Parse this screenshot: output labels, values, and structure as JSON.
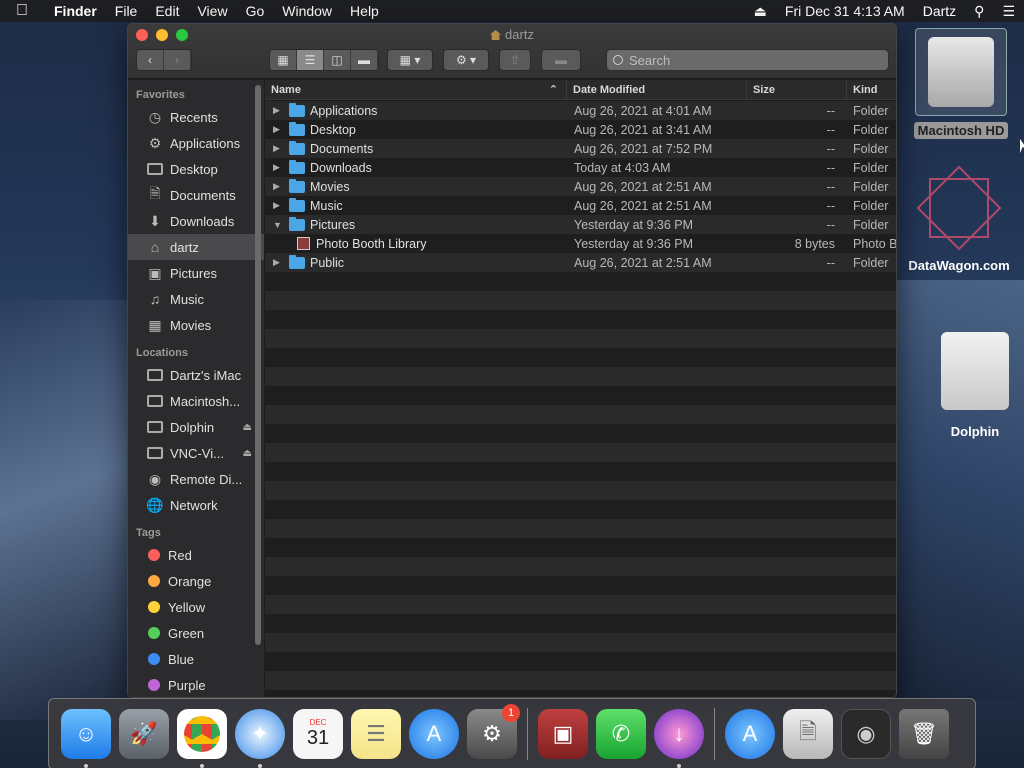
{
  "menubar": {
    "apple": "",
    "items": [
      "Finder",
      "File",
      "Edit",
      "View",
      "Go",
      "Window",
      "Help"
    ],
    "clock": "Fri Dec 31  4:13 AM",
    "user": "Dartz"
  },
  "window": {
    "title": "dartz",
    "search_placeholder": "Search"
  },
  "sidebar": {
    "favorites_header": "Favorites",
    "favorites": [
      {
        "label": "Recents",
        "icon": "clock-icon"
      },
      {
        "label": "Applications",
        "icon": "applications-icon"
      },
      {
        "label": "Desktop",
        "icon": "desktop-icon"
      },
      {
        "label": "Documents",
        "icon": "documents-icon"
      },
      {
        "label": "Downloads",
        "icon": "downloads-icon"
      },
      {
        "label": "dartz",
        "icon": "home-icon"
      },
      {
        "label": "Pictures",
        "icon": "camera-icon"
      },
      {
        "label": "Music",
        "icon": "music-icon"
      },
      {
        "label": "Movies",
        "icon": "film-icon"
      }
    ],
    "locations_header": "Locations",
    "locations": [
      {
        "label": "Dartz's iMac",
        "icon": "imac-icon"
      },
      {
        "label": "Macintosh...",
        "icon": "hard-drive-icon"
      },
      {
        "label": "Dolphin",
        "icon": "drive-icon"
      },
      {
        "label": "VNC-Vi...",
        "icon": "drive-icon"
      },
      {
        "label": "Remote Di...",
        "icon": "disc-icon"
      },
      {
        "label": "Network",
        "icon": "network-icon"
      }
    ],
    "tags_header": "Tags",
    "tags": [
      {
        "label": "Red",
        "color": "#fc605c"
      },
      {
        "label": "Orange",
        "color": "#fda943"
      },
      {
        "label": "Yellow",
        "color": "#fcd33a"
      },
      {
        "label": "Green",
        "color": "#54d05a"
      },
      {
        "label": "Blue",
        "color": "#3d8cf5"
      },
      {
        "label": "Purple",
        "color": "#c065d7"
      }
    ]
  },
  "columns": {
    "name": "Name",
    "date": "Date Modified",
    "size": "Size",
    "kind": "Kind"
  },
  "rows": [
    {
      "name": "Applications",
      "date": "Aug 26, 2021 at 4:01 AM",
      "size": "--",
      "kind": "Folder"
    },
    {
      "name": "Desktop",
      "date": "Aug 26, 2021 at 3:41 AM",
      "size": "--",
      "kind": "Folder"
    },
    {
      "name": "Documents",
      "date": "Aug 26, 2021 at 7:52 PM",
      "size": "--",
      "kind": "Folder"
    },
    {
      "name": "Downloads",
      "date": "Today at 4:03 AM",
      "size": "--",
      "kind": "Folder"
    },
    {
      "name": "Movies",
      "date": "Aug 26, 2021 at 2:51 AM",
      "size": "--",
      "kind": "Folder"
    },
    {
      "name": "Music",
      "date": "Aug 26, 2021 at 2:51 AM",
      "size": "--",
      "kind": "Folder"
    },
    {
      "name": "Pictures",
      "date": "Yesterday at 9:36 PM",
      "size": "--",
      "kind": "Folder"
    },
    {
      "name": "Photo Booth Library",
      "date": "Yesterday at 9:36 PM",
      "size": "8 bytes",
      "kind": "Photo B"
    },
    {
      "name": "Public",
      "date": "Aug 26, 2021 at 2:51 AM",
      "size": "--",
      "kind": "Folder"
    }
  ],
  "desktop": {
    "hd_label": "Macintosh HD",
    "datawagon_label": "DataWagon.com",
    "dolphin_label": "Dolphin"
  },
  "dock": {
    "calendar_month": "DEC",
    "calendar_day": "31",
    "badge": "1"
  }
}
